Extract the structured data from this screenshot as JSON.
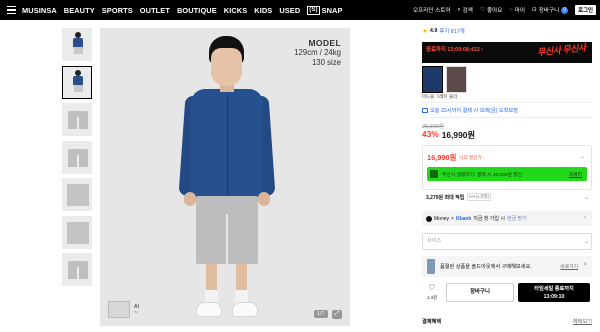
{
  "nav": {
    "items": [
      "MUSINSA",
      "BEAUTY",
      "SPORTS",
      "OUTLET",
      "BOUTIQUE",
      "KICKS",
      "KIDS",
      "USED"
    ],
    "snap_prefix": "(S)",
    "snap_label": "SNAP",
    "right": {
      "offline": "오프라인 스토어",
      "search": "검색",
      "likes": "좋아요",
      "my": "마이",
      "cart": "장바구니",
      "cart_count": "0",
      "login": "로그인"
    }
  },
  "gallery": {
    "model_title": "MODEL",
    "model_stats": "129cm / 24kg",
    "model_size": "130 size",
    "ai_label_top": "AI",
    "ai_label_bottom": "~",
    "pager": "1/7",
    "thumbnail_count": 7
  },
  "product": {
    "rating": "4.9",
    "review_link": "후기 817개",
    "promo_text": "종료까지 13:09:08:432 ›",
    "promo_badge": "무신사 무신사",
    "colors": [
      "미드블 그레이",
      "블리"
    ],
    "shipping": "오늘 22시까지 결제 시 모레(금) 도착보장",
    "original_price": "29,900원",
    "discount": "43%",
    "sale_price": "16,990원",
    "my_price": "16,990원",
    "my_price_sub": "나의 할인가 ›",
    "coupon_text": "무신사 생활하기: 결제 시 30,000원 할인",
    "coupon_btn": "자세히",
    "points": "3,279원 최대 적립",
    "points_tag": "5%(4개월)",
    "money_brand": "Money",
    "money_partner": "Kbank",
    "money_text": "지금 첫 가입 시",
    "money_extra": "현금 받기",
    "size_placeholder": "사이즈",
    "notice_text": "품절된 상품을 솔드아웃에서 구매해보세요.",
    "notice_btn": "바로가기",
    "like_count": "1.4천",
    "cart_btn": "장바구니",
    "buy_btn_line1": "타임세일 종료까지",
    "buy_btn_line2": "13:09:10",
    "payment_label": "결제혜택",
    "payment_more": "혜택보기"
  }
}
